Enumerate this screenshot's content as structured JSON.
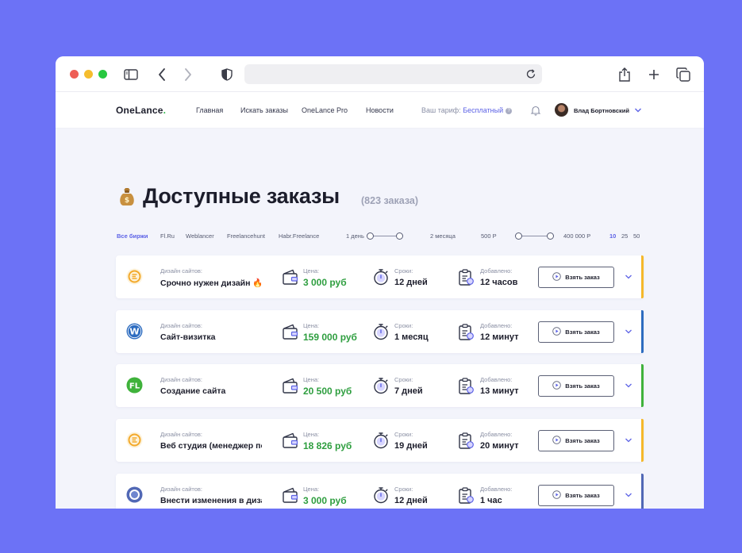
{
  "logo": {
    "text": "OneLance",
    "dot": "."
  },
  "nav": {
    "links": [
      "Главная",
      "Искать заказы",
      "OneLance Pro",
      "Новости"
    ]
  },
  "tariff": {
    "label": "Ваш тариф:",
    "plan": "Бесплатный"
  },
  "user": {
    "name": "Влад Бортновский"
  },
  "page": {
    "emoji": "money-bag-icon",
    "title": "Доступные заказы",
    "count": "(823 заказа)"
  },
  "filters": {
    "sources": [
      "Все биржи",
      "Fl.Ru",
      "Weblancer",
      "Freelancehunt",
      "Habr.Freelance"
    ],
    "duration": {
      "min_label": "1 день",
      "max_label": "2 месяца"
    },
    "price": {
      "min_label": "500 Р",
      "max_label": "400 000 Р"
    },
    "per_page": [
      "10",
      "25",
      "50"
    ]
  },
  "labels": {
    "price": "Цена:",
    "deadline": "Сроки:",
    "added": "Добавлено:",
    "take": "Взять заказ"
  },
  "orders": [
    {
      "category": "Дизайн сайтов:",
      "title": "Срочно нужен дизайн",
      "fire": "🔥",
      "price": "3 000 руб",
      "deadline": "12 дней",
      "added": "12 часов",
      "source": "freelancehunt",
      "stripe": "#f5b82a"
    },
    {
      "category": "Дизайн сайтов:",
      "title": "Сайт-визитка",
      "fire": "",
      "price": "159 000 руб",
      "deadline": "1 месяц",
      "added": "12 минут",
      "source": "weblancer",
      "stripe": "#2d6cc0"
    },
    {
      "category": "Дизайн сайтов:",
      "title": "Создание сайта",
      "fire": "",
      "price": "20 500 руб",
      "deadline": "7 дней",
      "added": "13 минут",
      "source": "flru",
      "stripe": "#3fb23b"
    },
    {
      "category": "Дизайн сайтов:",
      "title": "Веб студия (менеджер по продажам)",
      "fire": "",
      "price": "18 826 руб",
      "deadline": "19 дней",
      "added": "20 минут",
      "source": "freelancehunt",
      "stripe": "#f5b82a"
    },
    {
      "category": "Дизайн сайтов:",
      "title": "Внести изменения в дизайн",
      "fire": "",
      "price": "3 000 руб",
      "deadline": "12 дней",
      "added": "1 час",
      "source": "habr",
      "stripe": "#5168b5"
    }
  ]
}
